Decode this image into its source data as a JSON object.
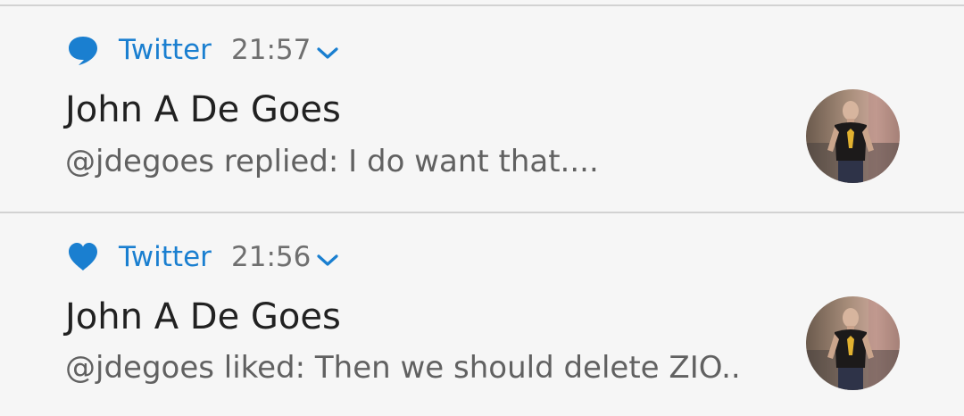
{
  "notifications": [
    {
      "app_name": "Twitter",
      "time": "21:57",
      "app_icon": "speech-bubble-icon",
      "title": "John A De Goes",
      "text": "@jdegoes replied: I do want that....",
      "avatar": "profile-photo"
    },
    {
      "app_name": "Twitter",
      "time": "21:56",
      "app_icon": "heart-icon",
      "title": "John A De Goes",
      "text": "@jdegoes liked: Then we should delete ZIO..",
      "avatar": "profile-photo"
    }
  ],
  "colors": {
    "accent": "#1a7fd0",
    "background": "#f6f6f6",
    "divider": "#d2d2d2",
    "title_text": "#212121",
    "body_text": "#616161",
    "time_text": "#6f6f6f"
  }
}
